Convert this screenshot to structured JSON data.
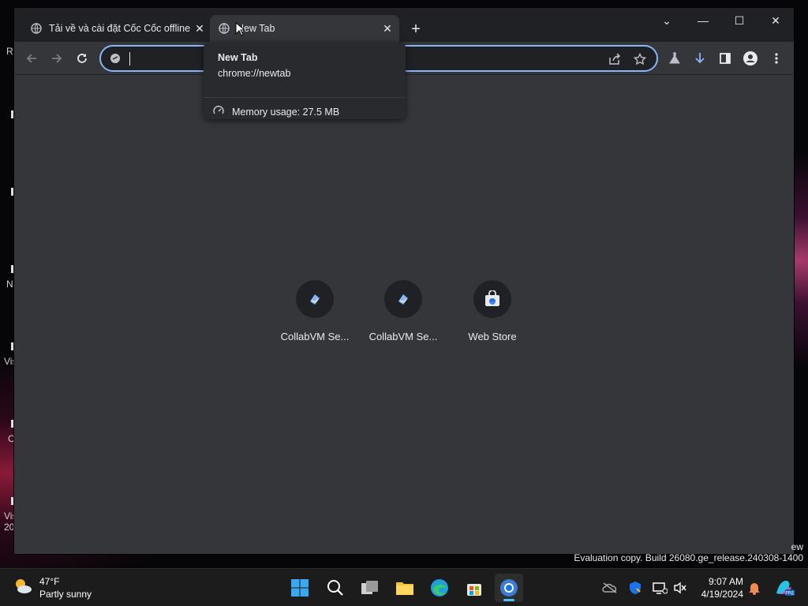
{
  "tabs": [
    {
      "title": "Tải về và cài đặt Cốc Cốc offline",
      "close": "✕"
    },
    {
      "title": "New Tab",
      "close": "✕"
    }
  ],
  "new_tab_symbol": "+",
  "window_controls": {
    "tab_search": "⌄",
    "minimize": "—",
    "maximize": "☐",
    "close": "✕"
  },
  "omnibox": {
    "value": "",
    "placeholder": ""
  },
  "hovercard": {
    "title": "New Tab",
    "url": "chrome://newtab",
    "memory": "Memory usage: 27.5 MB"
  },
  "shortcuts": [
    {
      "label": "CollabVM Se...",
      "icon": "collabvm-icon"
    },
    {
      "label": "CollabVM Se...",
      "icon": "collabvm-icon"
    },
    {
      "label": "Web Store",
      "icon": "web-store-icon"
    }
  ],
  "watermark": {
    "line_top": "ew",
    "line": "Evaluation copy. Build 26080.ge_release.240308-1400"
  },
  "desktop_fragments": [
    "R",
    "N",
    "Vis",
    "C",
    "Vis",
    "20"
  ],
  "weather": {
    "temp": "47°F",
    "condition": "Partly sunny"
  },
  "clock": {
    "time": "9:07 AM",
    "date": "4/19/2024"
  },
  "colors": {
    "tab_strip": "#202124",
    "toolbar": "#35363a",
    "omnibox_focus": "#8ab4f8",
    "taskbar_accent": "#4cc2ff"
  }
}
